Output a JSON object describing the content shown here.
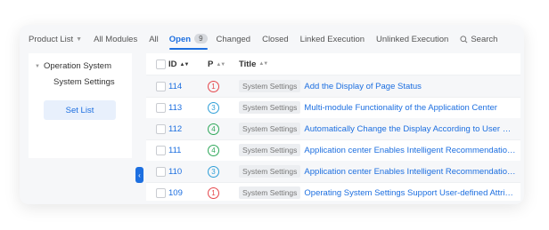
{
  "nav": {
    "product_list": "Product List",
    "all_modules": "All Modules",
    "all": "All",
    "open": "Open",
    "open_count": "9",
    "changed": "Changed",
    "closed": "Closed",
    "linked_execution": "Linked Execution",
    "unlinked_execution": "Unlinked Execution",
    "search": "Search"
  },
  "sidebar": {
    "root": "Operation System",
    "child": "System Settings",
    "set_list": "Set List"
  },
  "table": {
    "headers": {
      "id": "ID",
      "p": "P",
      "title": "Title"
    },
    "rows": [
      {
        "id": "114",
        "p": "1",
        "tag": "System Settings",
        "title": "Add the Display of Page Status"
      },
      {
        "id": "113",
        "p": "3",
        "tag": "System Settings",
        "title": "Multi-module Functionality of the Application Center"
      },
      {
        "id": "112",
        "p": "4",
        "tag": "System Settings",
        "title": "Automatically Change the Display According to User Habits"
      },
      {
        "id": "111",
        "p": "4",
        "tag": "System Settings",
        "title": "Application center Enables Intelligent Recommendation of ..."
      },
      {
        "id": "110",
        "p": "3",
        "tag": "System Settings",
        "title": "Application center Enables Intelligent Recommendation of ..."
      },
      {
        "id": "109",
        "p": "1",
        "tag": "System Settings",
        "title": "Operating System Settings Support User-defined Attributes"
      }
    ]
  },
  "colors": {
    "accent": "#1d6fe0",
    "priority_1": "#e5484d",
    "priority_3": "#2f9fd8",
    "priority_4": "#2fa85a"
  },
  "icons": {
    "search": "search-icon",
    "collapse": "chevron-left-icon"
  }
}
